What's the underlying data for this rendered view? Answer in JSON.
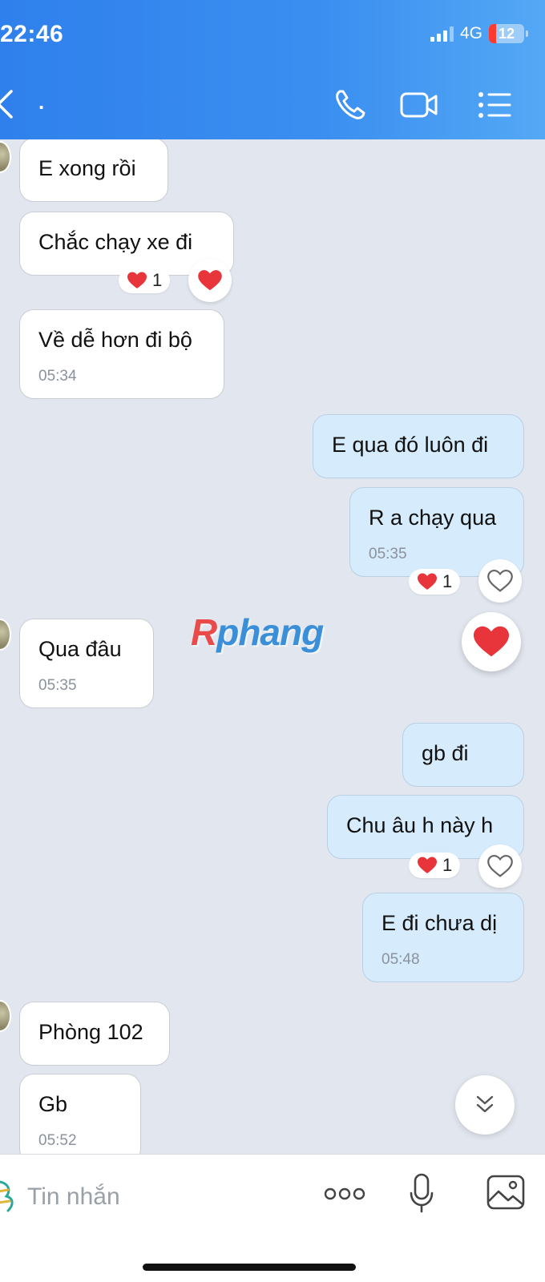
{
  "status_bar": {
    "time": "22:46",
    "network": "4G",
    "battery": "12"
  },
  "header": {
    "contact_name": "."
  },
  "messages": [
    {
      "text": "E xong rồi"
    },
    {
      "text": "Chắc chạy xe đi",
      "reaction_count": "1"
    },
    {
      "text": "Về dễ hơn đi bộ",
      "time": "05:34"
    },
    {
      "text": "E qua đó luôn đi"
    },
    {
      "text": "R a chạy qua",
      "time": "05:35",
      "reaction_count": "1"
    },
    {
      "text": "Qua đâu",
      "time": "05:35"
    },
    {
      "text": "gb đi"
    },
    {
      "text": "Chu âu h này h",
      "reaction_count": "1"
    },
    {
      "text": "E đi chưa dị",
      "time": "05:48"
    },
    {
      "text": "Phòng 102"
    },
    {
      "text": "Gb",
      "time": "05:52"
    }
  ],
  "watermark": {
    "first": "R",
    "rest": "phang"
  },
  "input": {
    "placeholder": "Tin nhắn"
  },
  "colors": {
    "header": "#2f80ec",
    "outgoing_bubble": "#d6ebfb",
    "incoming_bubble": "#ffffff",
    "background": "#e2e7ef",
    "heart": "#e8343b"
  }
}
